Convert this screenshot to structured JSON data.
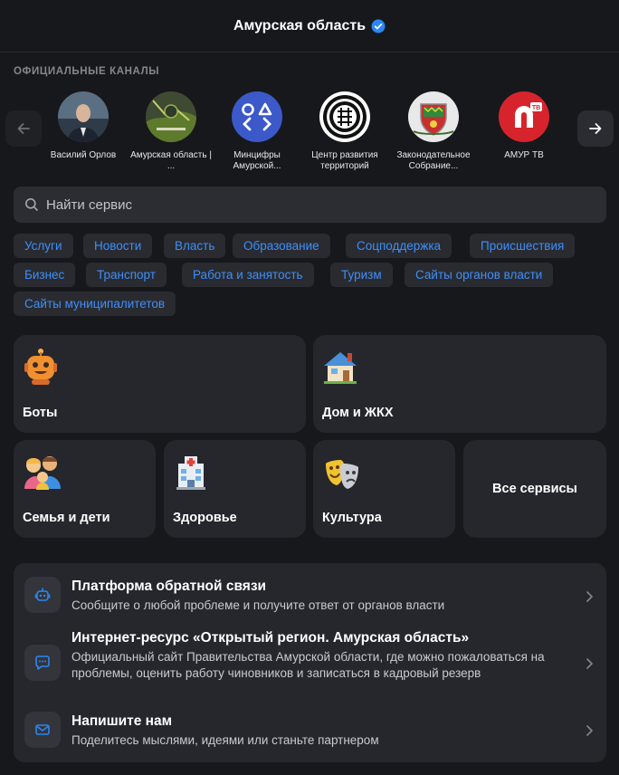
{
  "header": {
    "title": "Амурская область",
    "verified_icon": "verified-check-icon",
    "accent": "#2a87f5"
  },
  "channels": {
    "section_title": "ОФИЦИАЛЬНЫЕ КАНАЛЫ",
    "items": [
      {
        "name": "Василий Орлов"
      },
      {
        "name": "Амурская область | ..."
      },
      {
        "name": "Минцифры Амурской..."
      },
      {
        "name": "Центр развития территорий"
      },
      {
        "name": "Законодательное Собрание..."
      },
      {
        "name": "АМУР ТВ",
        "badge": "ТВ"
      }
    ]
  },
  "search": {
    "placeholder": "Найти сервис"
  },
  "tags": [
    "Услуги",
    "Новости",
    "Власть",
    "Образование",
    "Соцподдержка",
    "Происшествия",
    "Бизнес",
    "Транспорт",
    "Работа и занятость",
    "Туризм",
    "Сайты органов власти",
    "Сайты муниципалитетов"
  ],
  "cards": {
    "bots": "Боты",
    "home": "Дом и ЖКХ",
    "family": "Семья и дети",
    "health": "Здоровье",
    "culture": "Культура",
    "all": "Все сервисы"
  },
  "info": [
    {
      "title": "Платформа обратной связи",
      "desc": "Сообщите о любой проблеме и получите ответ от органов власти",
      "icon": "bot-icon"
    },
    {
      "title": "Интернет-ресурс «Открытый регион. Амурская область»",
      "desc": "Официальный сайт Правительства Амурской области, где можно пожаловаться на проблемы, оценить работу чиновников и записаться в кадровый резерв",
      "icon": "chat-icon"
    },
    {
      "title": "Напишите нам",
      "desc": "Поделитесь мыслями, идеями или станьте партнером",
      "icon": "mail-icon"
    }
  ],
  "colors": {
    "background": "#17181c",
    "card": "#26272c",
    "tag_text": "#3d8ffa",
    "muted": "#85878d"
  }
}
